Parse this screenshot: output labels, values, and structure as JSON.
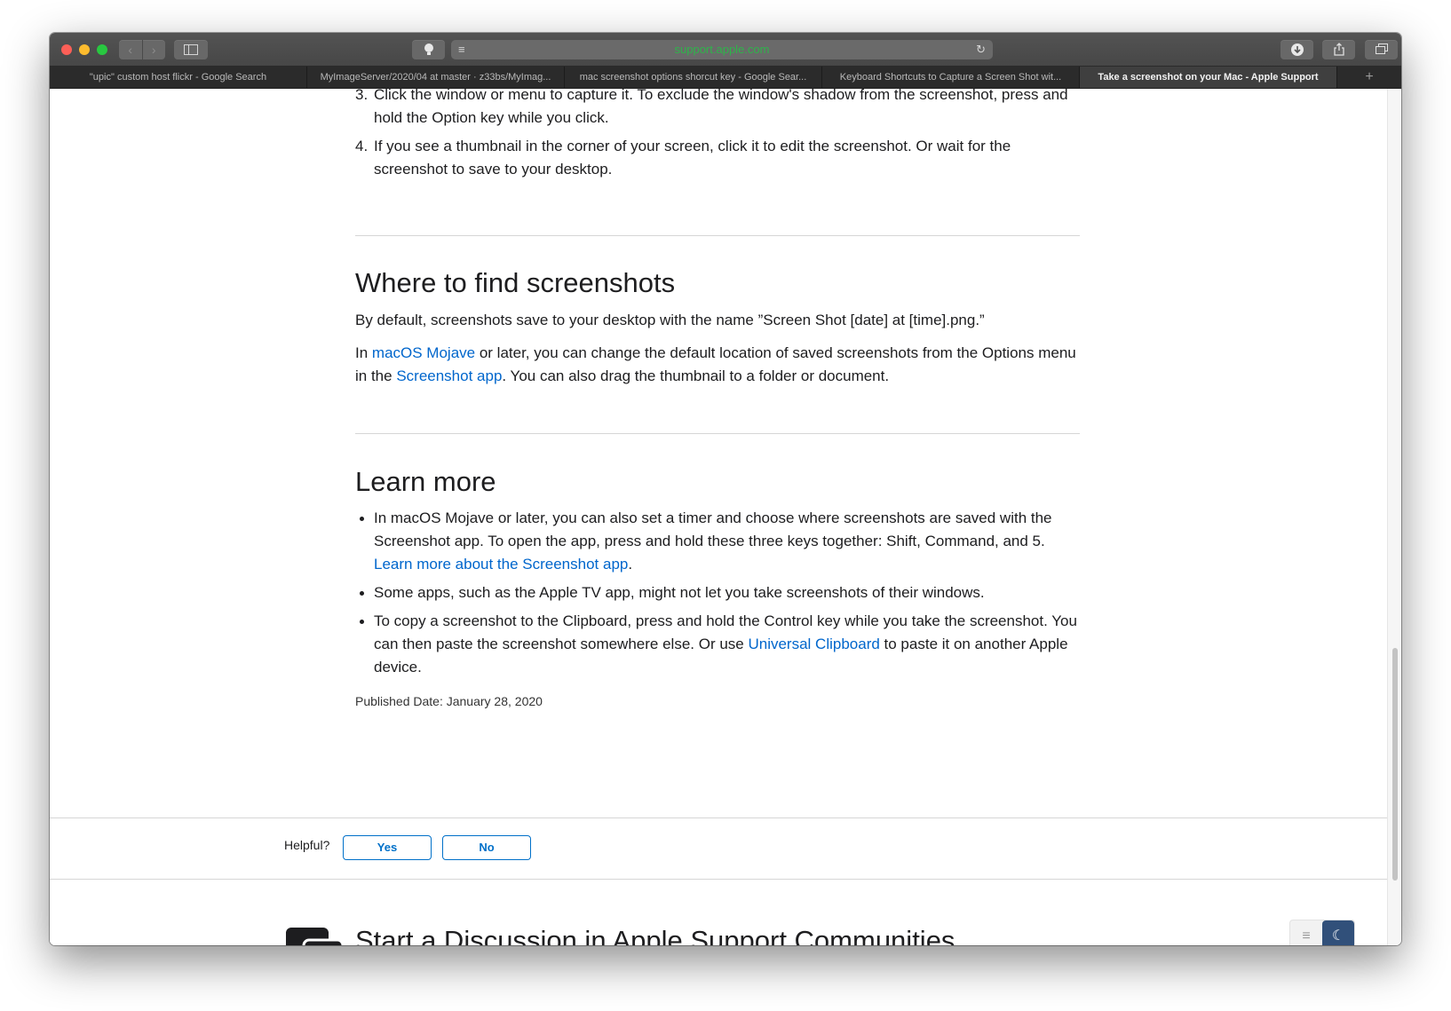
{
  "browser": {
    "url_text": "support.apple.com",
    "nav_back_icon": "chevron-left-icon",
    "nav_forward_icon": "chevron-right-icon",
    "tabs": [
      {
        "label": "\"upic\" custom host flickr - Google Search"
      },
      {
        "label": "MyImageServer/2020/04 at master · z33bs/MyImag..."
      },
      {
        "label": "mac screenshot options shorcut key - Google Sear..."
      },
      {
        "label": "Keyboard Shortcuts to Capture a Screen Shot wit..."
      },
      {
        "label": "Take a screenshot on your Mac - Apple Support",
        "active": true
      }
    ],
    "new_tab_glyph": "+"
  },
  "article": {
    "steps": [
      {
        "num": "3.",
        "text": "Click the window or menu to capture it. To exclude the window's shadow from the screenshot, press and hold the Option key while you click."
      },
      {
        "num": "4.",
        "text": "If you see a thumbnail in the corner of your screen, click it to edit the screenshot. Or wait for the screenshot to save to your desktop."
      }
    ],
    "find_section": {
      "heading": "Where to find screenshots",
      "p1": "By default, screenshots save to your desktop with the name ”Screen Shot [date] at [time].png.”",
      "p2_a": "In ",
      "p2_link1": "macOS Mojave",
      "p2_b": " or later, you can change the default location of saved screenshots from the Options menu in the ",
      "p2_link2": "Screenshot app",
      "p2_c": ". You can also drag the thumbnail to a folder or document."
    },
    "learn_section": {
      "heading": "Learn more",
      "b1_text": "In macOS Mojave or later, you can also set a timer and choose where screenshots are saved with the Screenshot app. To open the app, press and hold these three keys together: Shift, Command, and 5. ",
      "b1_link": "Learn more about the Screenshot app",
      "b1_end": ".",
      "b2_text": "Some apps, such as the Apple TV app, might not let you take screenshots of their windows.",
      "b3_text": "To copy a screenshot to the Clipboard, press and hold the Control key while you take the screenshot. You can then paste the screenshot somewhere else. Or use ",
      "b3_link": "Universal Clipboard",
      "b3_end": " to paste it on another Apple device."
    },
    "published": "Published Date: January 28, 2020"
  },
  "helpful": {
    "label": "Helpful?",
    "yes": "Yes",
    "no": "No"
  },
  "community": {
    "title": "Start a Discussion in Apple Support Communities",
    "icon": "speech-bubbles-icon"
  },
  "colors": {
    "link": "#0066cc",
    "text": "#1d1d1f",
    "toggle_dark": "#31507a"
  }
}
